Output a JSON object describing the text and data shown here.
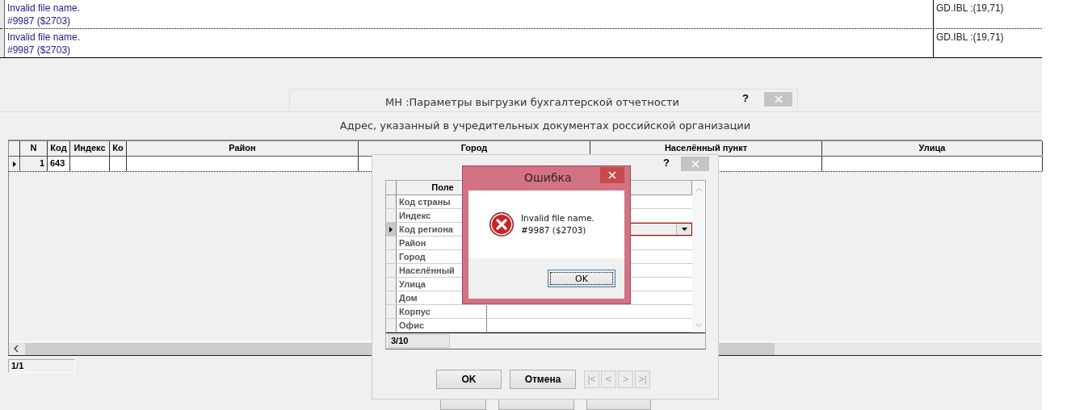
{
  "log": {
    "rows": [
      {
        "lines": [
          "Invalid file name.",
          "#9987 ($2703)"
        ],
        "source": "GD.IBL :(19,71)"
      },
      {
        "lines": [
          "Invalid file name.",
          "#9987 ($2703)"
        ],
        "source": "GD.IBL :(19,71)"
      }
    ]
  },
  "main_dialog": {
    "title": "МН :Параметры выгрузки бухгалтерской отчетности",
    "help": "?",
    "heading": "Адрес, указанный в учредительных документах российской организации",
    "grid": {
      "columns": [
        "N",
        "Код",
        "Индекс",
        "Ко",
        "Район",
        "Город",
        "Населённый пункт",
        "Улица"
      ],
      "rows": [
        {
          "selected": true,
          "n": "1",
          "code": "643"
        }
      ]
    },
    "counter": "1/1"
  },
  "field_dialog": {
    "help": "?",
    "column": "Поле",
    "rows": [
      {
        "label": "Код страны",
        "selected": false
      },
      {
        "label": "Индекс",
        "selected": false
      },
      {
        "label": "Код региона",
        "selected": true
      },
      {
        "label": "Район",
        "selected": false
      },
      {
        "label": "Город",
        "selected": false
      },
      {
        "label": "Населённый",
        "selected": false
      },
      {
        "label": "Улица",
        "selected": false
      },
      {
        "label": "Дом",
        "selected": false
      },
      {
        "label": "Корпус",
        "selected": false
      },
      {
        "label": "Офис",
        "selected": false
      }
    ],
    "counter": "3/10",
    "buttons": [
      "OK",
      "Отмена"
    ],
    "nav": [
      {
        "label": "|<",
        "disabled": true
      },
      {
        "label": "<",
        "disabled": true
      },
      {
        "label": ">",
        "disabled": true
      },
      {
        "label": ">|",
        "disabled": true
      }
    ]
  },
  "error_dialog": {
    "title": "Ошибка",
    "lines": [
      "Invalid file name.",
      "#9987 ($2703)"
    ],
    "button": "OK"
  }
}
